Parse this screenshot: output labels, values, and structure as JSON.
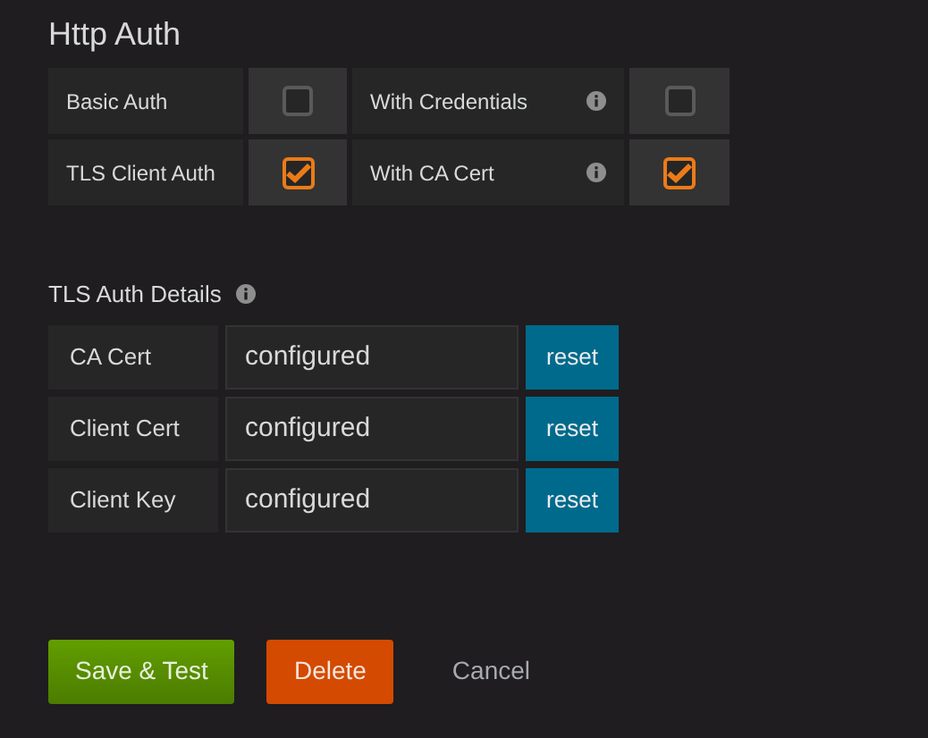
{
  "section_title": "Http Auth",
  "auth_options": [
    {
      "label": "Basic Auth",
      "info": false,
      "checked": false
    },
    {
      "label": "With Credentials",
      "info": true,
      "checked": false
    },
    {
      "label": "TLS Client Auth",
      "info": false,
      "checked": true
    },
    {
      "label": "With CA Cert",
      "info": true,
      "checked": true
    }
  ],
  "tls_title": "TLS Auth Details",
  "tls_fields": [
    {
      "label": "CA Cert",
      "value": "configured",
      "button": "reset"
    },
    {
      "label": "Client Cert",
      "value": "configured",
      "button": "reset"
    },
    {
      "label": "Client Key",
      "value": "configured",
      "button": "reset"
    }
  ],
  "buttons": [
    {
      "label": "Save & Test",
      "kind": "primary"
    },
    {
      "label": "Delete",
      "kind": "danger"
    },
    {
      "label": "Cancel",
      "kind": "link"
    }
  ]
}
